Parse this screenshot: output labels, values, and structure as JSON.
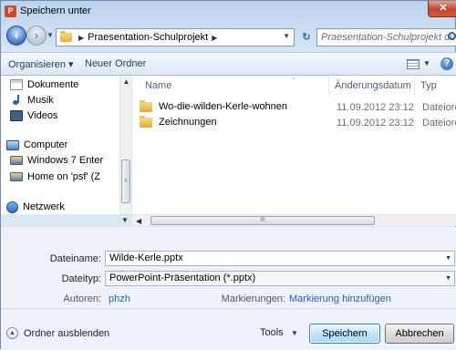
{
  "window": {
    "title": "Speichern unter",
    "app_icon_letter": "P",
    "close_glyph": "✕"
  },
  "address": {
    "breadcrumb": "Praesentation-Schulprojekt",
    "search_placeholder": "Praesentation-Schulprojekt du..."
  },
  "toolbar": {
    "organize_label": "Organisieren ▾",
    "new_folder_label": "Neuer Ordner"
  },
  "nav": {
    "items": [
      {
        "label": "Dokumente",
        "icon": "documents-icon"
      },
      {
        "label": "Musik",
        "icon": "music-icon"
      },
      {
        "label": "Videos",
        "icon": "videos-icon"
      },
      {
        "label": "Computer",
        "icon": "computer-icon"
      },
      {
        "label": "Windows 7 Enter",
        "icon": "drive-icon"
      },
      {
        "label": "Home on 'psf' (Z",
        "icon": "network-drive-icon"
      },
      {
        "label": "Netzwerk",
        "icon": "network-icon"
      }
    ]
  },
  "columns": {
    "name": "Name",
    "date": "Änderungsdatum",
    "type": "Typ"
  },
  "files": [
    {
      "name": "Wo-die-wilden-Kerle-wohnen",
      "date": "11.09.2012 23:12",
      "type": "Dateiord"
    },
    {
      "name": "Zeichnungen",
      "date": "11.09.2012 23:12",
      "type": "Dateiord"
    }
  ],
  "form": {
    "filename_label": "Dateiname:",
    "filename_value": "Wilde-Kerle.pptx",
    "filetype_label": "Dateityp:",
    "filetype_value": "PowerPoint-Präsentation (*.pptx)",
    "authors_label": "Autoren:",
    "authors_value": "phzh",
    "tags_label": "Markierungen:",
    "tags_value": "Markierung hinzufügen"
  },
  "footer": {
    "hide_folders_label": "Ordner ausblenden",
    "tools_label": "Tools",
    "save_label": "Speichern",
    "cancel_label": "Abbrechen"
  }
}
